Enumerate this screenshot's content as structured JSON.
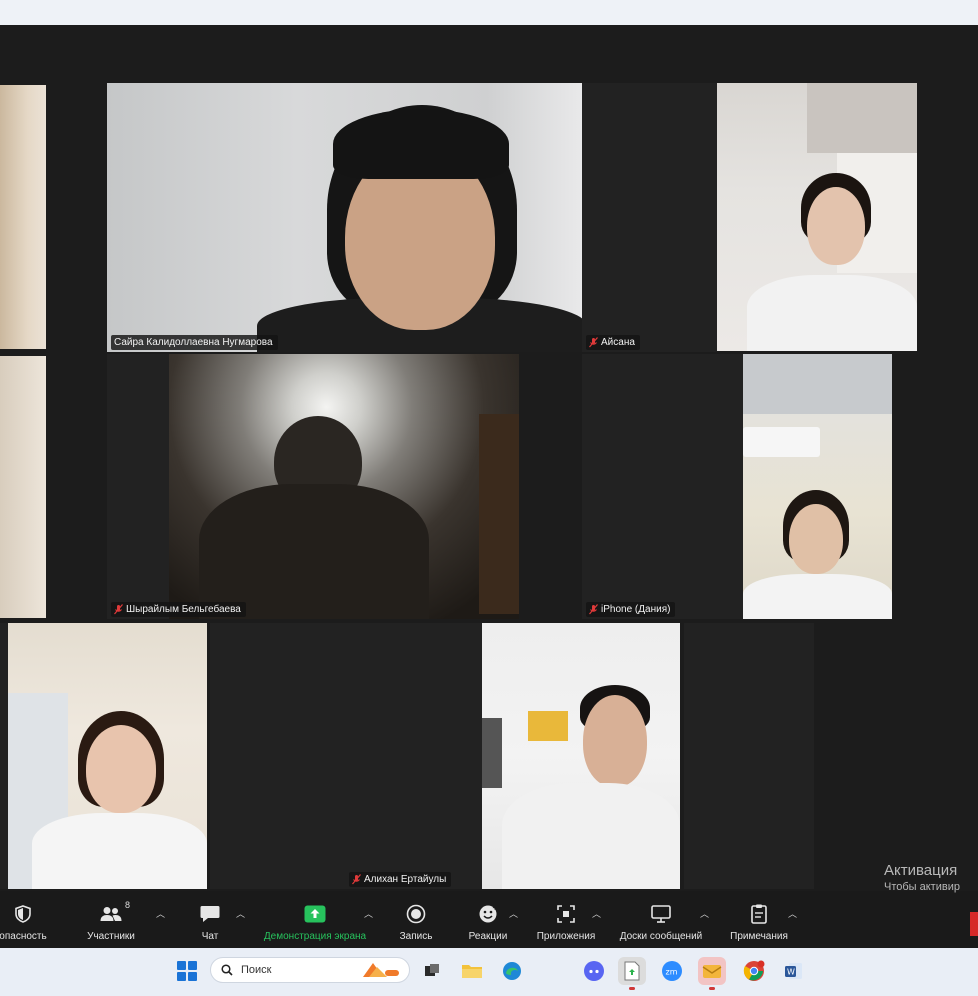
{
  "participants": {
    "teacher": {
      "name": "Сайра Калидоллаевна Нугмарова"
    },
    "aisana": {
      "name": "Айсана"
    },
    "shyrailym": {
      "name": "Шырайлым Бельгебаева"
    },
    "dania": {
      "name": "iPhone (Дания)"
    },
    "alikhan": {
      "name": "Алихан Ертайулы"
    }
  },
  "toolbar": {
    "security": "опасность",
    "participants": "Участники",
    "participants_count": "8",
    "chat": "Чат",
    "share": "Демонстрация экрана",
    "record": "Запись",
    "reactions": "Реакции",
    "apps": "Приложения",
    "whiteboards": "Доски сообщений",
    "notes": "Примечания"
  },
  "activation": {
    "title": "Активация",
    "subtitle": "Чтобы активир"
  },
  "taskbar": {
    "search_placeholder": "Поиск"
  },
  "colors": {
    "active_speaker": "#b9e04a",
    "share_green": "#27c25d",
    "mic_off": "#e03a3a"
  }
}
